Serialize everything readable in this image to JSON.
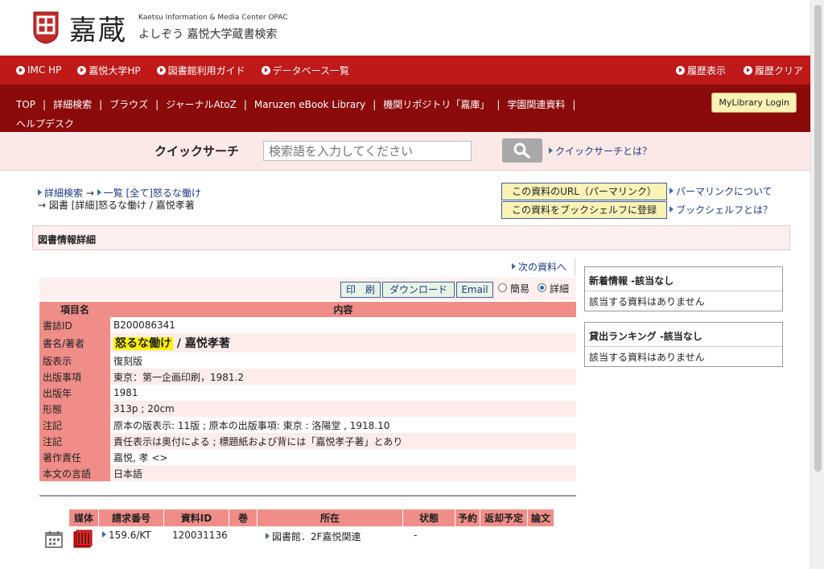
{
  "header": {
    "logo_text": "嘉蔵",
    "subtitle_en": "Kaetsu Information & Media Center OPAC",
    "subtitle_jp": "よしぞう 嘉悦大学蔵書検索"
  },
  "nav_main": [
    {
      "label": "IMC HP"
    },
    {
      "label": "嘉悦大学HP"
    },
    {
      "label": "図書館利用ガイド"
    },
    {
      "label": "データベース一覧"
    }
  ],
  "nav_right": [
    {
      "label": "履歴表示"
    },
    {
      "label": "履歴クリア"
    }
  ],
  "nav_sub": [
    {
      "label": "TOP"
    },
    {
      "label": "詳細検索"
    },
    {
      "label": "ブラウズ"
    },
    {
      "label": "ジャーナルAtoZ"
    },
    {
      "label": "Maruzen eBook Library"
    },
    {
      "label": "機関リポジトリ「嘉庫」"
    },
    {
      "label": "学園関連資料"
    },
    {
      "label": "ヘルプデスク"
    }
  ],
  "mylibrary_label": "MyLibrary Login",
  "quick_search": {
    "label": "クイックサーチ",
    "placeholder": "検索語を入力してください",
    "help": "クイックサーチとは？"
  },
  "breadcrumb": {
    "part1": "詳細検索",
    "arrow1": "→",
    "part2": "一覧 [全て]怒るな働け",
    "line2": "→ 図書 [詳細]怒るな働け / 嘉悦孝著"
  },
  "permalink": {
    "url_button": "この資料のURL（パーマリンク）",
    "url_help": "パーマリンクについて",
    "shelf_button": "この資料をブックシェルフに登録",
    "shelf_help": "ブックシェルフとは？"
  },
  "section_title": "図書情報詳細",
  "next_link": "次の資料へ",
  "toolbar": {
    "print": "印　刷",
    "download": "ダウンロード",
    "email": "Email",
    "simple": "簡易",
    "detail": "詳細"
  },
  "detail_table": {
    "header_key": "項目名",
    "header_value": "内容",
    "rows": [
      {
        "key": "書誌ID",
        "value": "B200086341"
      },
      {
        "key": "書名/著者",
        "title": "怒るな働け",
        "author": " / 嘉悦孝著"
      },
      {
        "key": "版表示",
        "value": "復刻版"
      },
      {
        "key": "出版事項",
        "value": "東京：第一企画印刷，1981.2"
      },
      {
        "key": "出版年",
        "value": "1981"
      },
      {
        "key": "形態",
        "value": "313p ; 20cm"
      },
      {
        "key": "注記",
        "value": "原本の版表示: 11版 ; 原本の出版事項: 東京 : 洛陽堂 , 1918.10"
      },
      {
        "key": "注記",
        "value": "責任表示は奥付による ; 標題紙および背には「嘉悦孝子著」とあり"
      },
      {
        "key": "著作責任",
        "value": "嘉悦, 孝 <>"
      },
      {
        "key": "本文の言語",
        "value": "日本語"
      }
    ]
  },
  "holdings": {
    "headers": [
      "媒体",
      "請求番号",
      "資料ID",
      "巻",
      "所在",
      "状態",
      "予約",
      "返却予定",
      "論文"
    ],
    "row": {
      "call_number": "159.6/KT",
      "item_id": "120031136",
      "location": "図書館．2F嘉悦関連",
      "status": "-"
    }
  },
  "side": {
    "new_title": "新着情報 -該当なし",
    "new_body": "該当する資料はありません",
    "rank_title": "貸出ランキング -該当なし",
    "rank_body": "該当する資料はありません"
  },
  "colors": {
    "nav_red": "#c01919",
    "nav_dark": "#8b0a0a",
    "table_key": "#f08d88",
    "highlight": "#fff200"
  }
}
